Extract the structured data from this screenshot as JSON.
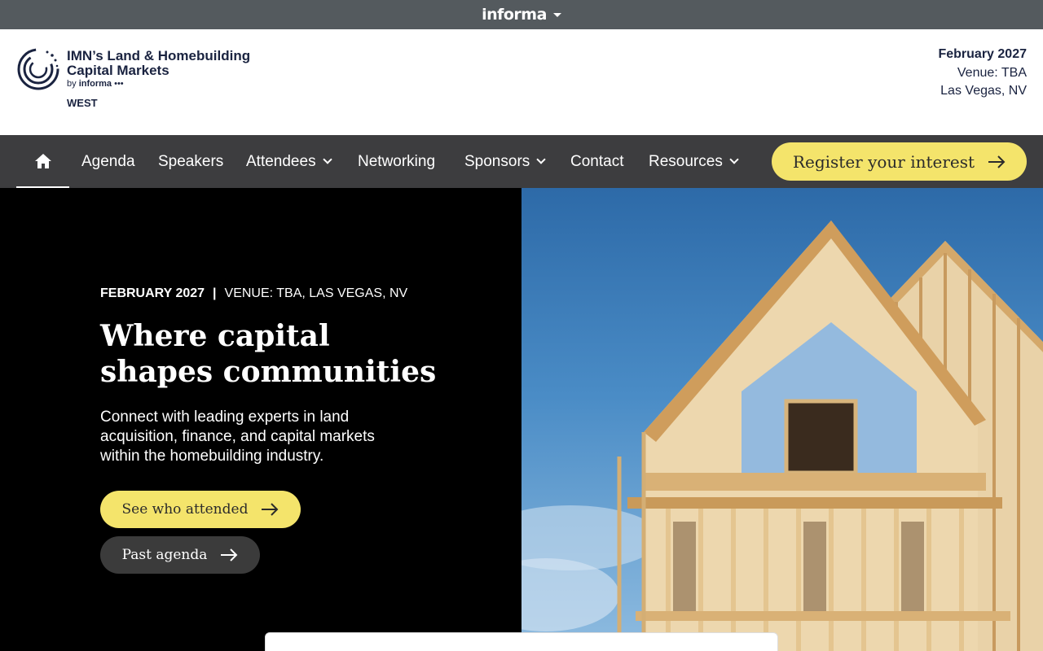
{
  "topbar": {
    "brand": "informa"
  },
  "header": {
    "logo": {
      "title": "IMN’s Land & Homebuilding Capital Markets",
      "by_prefix": "by",
      "by_brand": "informa",
      "region": "WEST"
    },
    "event": {
      "date": "February 2027",
      "venue": "Venue: TBA",
      "location": "Las Vegas, NV"
    }
  },
  "nav": {
    "home_icon": "home-icon",
    "items": [
      {
        "label": "Agenda",
        "dropdown": false
      },
      {
        "label": "Speakers",
        "dropdown": false
      },
      {
        "label": "Attendees",
        "dropdown": true
      },
      {
        "label": "Networking",
        "dropdown": false
      },
      {
        "label": "Sponsors",
        "dropdown": true
      },
      {
        "label": "Contact",
        "dropdown": false
      },
      {
        "label": "Resources",
        "dropdown": true
      }
    ],
    "register_label": "Register your interest"
  },
  "hero": {
    "date": "FEBRUARY 2027",
    "separator": "|",
    "venue": "VENUE: TBA, LAS VEGAS, NV",
    "title": "Where capital shapes communities",
    "description": "Connect with leading experts in land acquisition, finance, and capital markets within the homebuilding industry.",
    "primary_button": "See who attended",
    "secondary_button": "Past agenda"
  },
  "colors": {
    "accent_yellow": "#f4e46b",
    "nav_bg": "#3d3d3f",
    "topbar_bg": "#545a5e",
    "brand_navy": "#1a2340"
  }
}
